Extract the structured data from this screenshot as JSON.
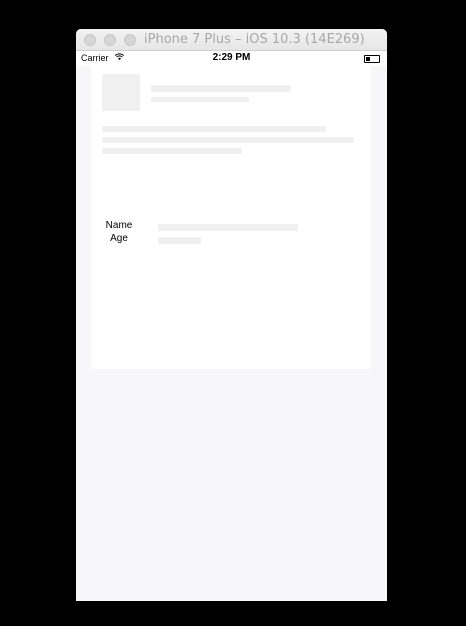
{
  "window": {
    "title": "iPhone 7 Plus – iOS 10.3 (14E269)"
  },
  "status_bar": {
    "carrier": "Carrier",
    "time": "2:29 PM",
    "wifi_icon": "wifi-icon",
    "battery_icon": "battery-icon"
  },
  "profile": {
    "name_label": "Name",
    "age_label": "Age"
  },
  "colors": {
    "placeholder": "#f0f0f0",
    "background": "#f7f7f9",
    "card": "#ffffff"
  }
}
